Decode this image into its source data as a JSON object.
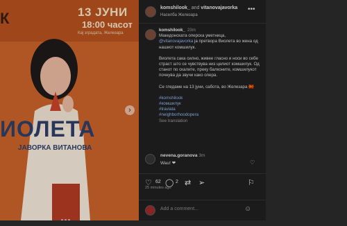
{
  "media": {
    "date": "13 ЈУНИ",
    "time": "18:00 часот",
    "venue": "Кај зградата, Железара",
    "corner_letter": "К",
    "title": "ИОЛЕТА",
    "author": "ЈАВОРКА ВИТАНОВА",
    "next_icon": "chevron-right-icon"
  },
  "header": {
    "user1": "komshilook_",
    "and_text": "and",
    "user2": "vitanovajavorka",
    "location": "Населба Железара",
    "more_icon": "more-icon"
  },
  "caption": {
    "user": "komshilook_",
    "ago": "23m",
    "line1": "Македонската оперска уметница,",
    "mention": "@vitanovajavorka",
    "line2": " ја претвора Виолета во жена од нашиот комшилук.",
    "para2": "Виолета сака силно, живее гласно и носи во себе страст што се чувствува низ целиот комшилук. Од станот по скалите, преку балконите, комшилукот почнува да звучи како опера.",
    "para3": "Се гледаме на 13 јуни, сабота, во Железара 🇲🇰",
    "tags": [
      "#komshilook",
      "#комшилук",
      "#traviata",
      "#neighborhoodopera"
    ],
    "see_translation": "See translation"
  },
  "comment": {
    "user": "nevena.goranova",
    "ago": "3m",
    "text": "Wau! ❤"
  },
  "actions": {
    "likes": "62",
    "comments": "2",
    "posted": "25 minutes ago"
  },
  "add_comment": {
    "placeholder": "Add a comment..."
  },
  "colors": {
    "poster_orange": "#c9622a",
    "poster_blue": "#2e3e66",
    "link_blue": "#8db4f0",
    "panel_bg": "#1f1f1f"
  }
}
